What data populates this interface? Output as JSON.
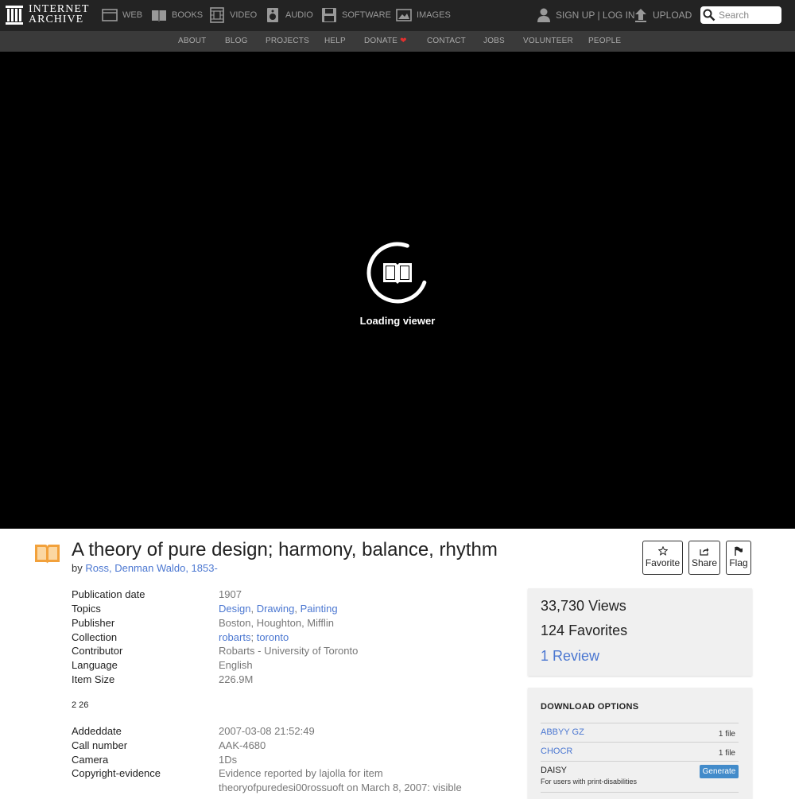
{
  "header": {
    "logo_line1": "INTERNET",
    "logo_line2": "ARCHIVE",
    "nav": [
      {
        "label": "Web",
        "icon": "web-icon"
      },
      {
        "label": "Books",
        "icon": "books-icon"
      },
      {
        "label": "Video",
        "icon": "video-icon"
      },
      {
        "label": "Audio",
        "icon": "audio-icon"
      },
      {
        "label": "Software",
        "icon": "software-icon"
      },
      {
        "label": "Images",
        "icon": "images-icon"
      }
    ],
    "auth": "SIGN UP | LOG IN",
    "upload": "UPLOAD",
    "search_placeholder": "Search"
  },
  "subnav": [
    "ABOUT",
    "BLOG",
    "PROJECTS",
    "HELP",
    "DONATE",
    "CONTACT",
    "JOBS",
    "VOLUNTEER",
    "PEOPLE"
  ],
  "viewer": {
    "loading": "Loading viewer"
  },
  "item": {
    "title": "A theory of pure design; harmony, balance, rhythm",
    "by": "by",
    "author": "Ross, Denman Waldo, 1853-",
    "actions": {
      "favorite": "Favorite",
      "share": "Share",
      "flag": "Flag"
    },
    "meta": [
      {
        "label": "Publication date",
        "value": "1907",
        "link": true
      },
      {
        "label": "Topics",
        "links": [
          "Design",
          "Drawing",
          "Painting"
        ]
      },
      {
        "label": "Publisher",
        "value": "Boston, Houghton, Mifflin",
        "link": false
      },
      {
        "label": "Collection",
        "links": [
          "robarts",
          "toronto"
        ],
        "sep": "; "
      },
      {
        "label": "Contributor",
        "value": "Robarts - University of Toronto",
        "link": true
      },
      {
        "label": "Language",
        "value": "English",
        "link": true
      },
      {
        "label": "Item Size",
        "value": "226.9M",
        "link": false
      }
    ],
    "note": "2 26",
    "meta2": [
      {
        "label": "Addeddate",
        "value": "2007-03-08 21:52:49"
      },
      {
        "label": "Call number",
        "value": "AAK-4680"
      },
      {
        "label": "Camera",
        "value": "1Ds"
      },
      {
        "label": "Copyright-evidence",
        "value": "Evidence reported by lajolla for item",
        "value2": "theoryofpuredesi00rossuoft on March 8, 2007: visible"
      }
    ]
  },
  "stats": {
    "views_num": "33,730",
    "views_label": "Views",
    "favorites_num": "124",
    "favorites_label": "Favorites",
    "reviews": "1 Review"
  },
  "downloads": {
    "title": "DOWNLOAD OPTIONS",
    "rows": [
      {
        "name": "ABBYY GZ",
        "count": "1 file"
      },
      {
        "name": "CHOCR",
        "count": "1 file"
      }
    ],
    "daisy": "DAISY",
    "daisy_sub": "For users with print-disabilities",
    "generate": "Generate"
  },
  "colors": {
    "accent_link": "#4b77d1",
    "book_icon": "#f2a13b",
    "donate_heart": "#e0302f",
    "generate_button": "#428bca"
  }
}
